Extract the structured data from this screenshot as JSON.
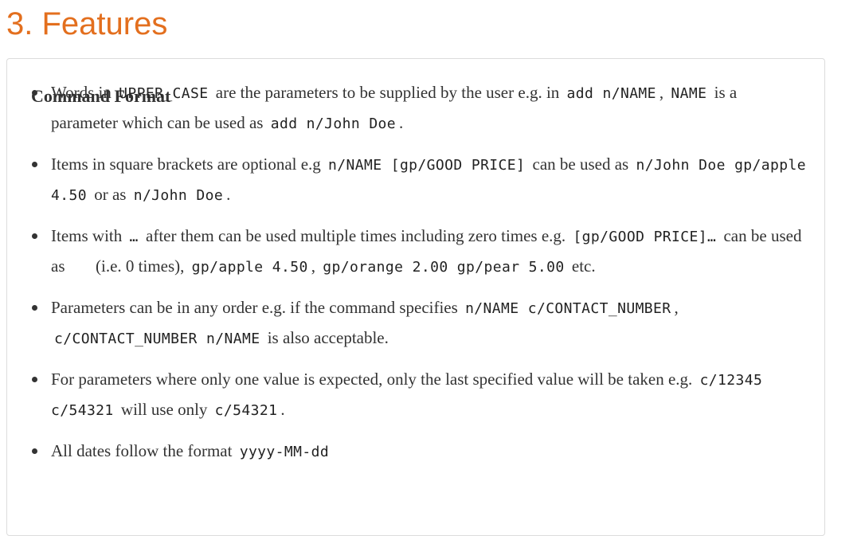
{
  "page": {
    "title": "3. Features"
  },
  "box": {
    "heading": "Command Format"
  },
  "rules": [
    {
      "t1": "Words in",
      "c1": "UPPER_CASE",
      "t2": "are the parameters to be supplied by the user e.g. in",
      "c2": "add n/NAME",
      "t3": ",",
      "c3": "NAME",
      "t4": "is a parameter which can be used as",
      "c4": "add n/John Doe",
      "t5": "."
    },
    {
      "t1": "Items in square brackets are optional e.g",
      "c1": "n/NAME [gp/GOOD PRICE]",
      "t2": "can be used as",
      "c2": "n/John Doe gp/apple 4.50",
      "t3": "or as",
      "c3": "n/John Doe",
      "t4": "."
    },
    {
      "t1": "Items with",
      "c1": "…",
      "t2": "after them can be used multiple times including zero times e.g.",
      "c2": "[gp/GOOD PRICE]…",
      "t3": "can be used as",
      "c3": " ",
      "t4": "(i.e. 0 times),",
      "c4": "gp/apple 4.50",
      "t5": ",",
      "c5": "gp/orange 2.00 gp/pear 5.00",
      "t6": "etc."
    },
    {
      "t1": "Parameters can be in any order e.g. if the command specifies",
      "c1": "n/NAME c/CONTACT_NUMBER",
      "t2": ",",
      "c2": "c/CONTACT_NUMBER n/NAME",
      "t3": "is also acceptable."
    },
    {
      "t1": "For parameters where only one value is expected, only the last specified value will be taken e.g.",
      "c1": "c/12345 c/54321",
      "t2": "will use only",
      "c2": "c/54321",
      "t3": "."
    },
    {
      "t1": "All dates follow the format",
      "c1": "yyyy-MM-dd"
    }
  ]
}
